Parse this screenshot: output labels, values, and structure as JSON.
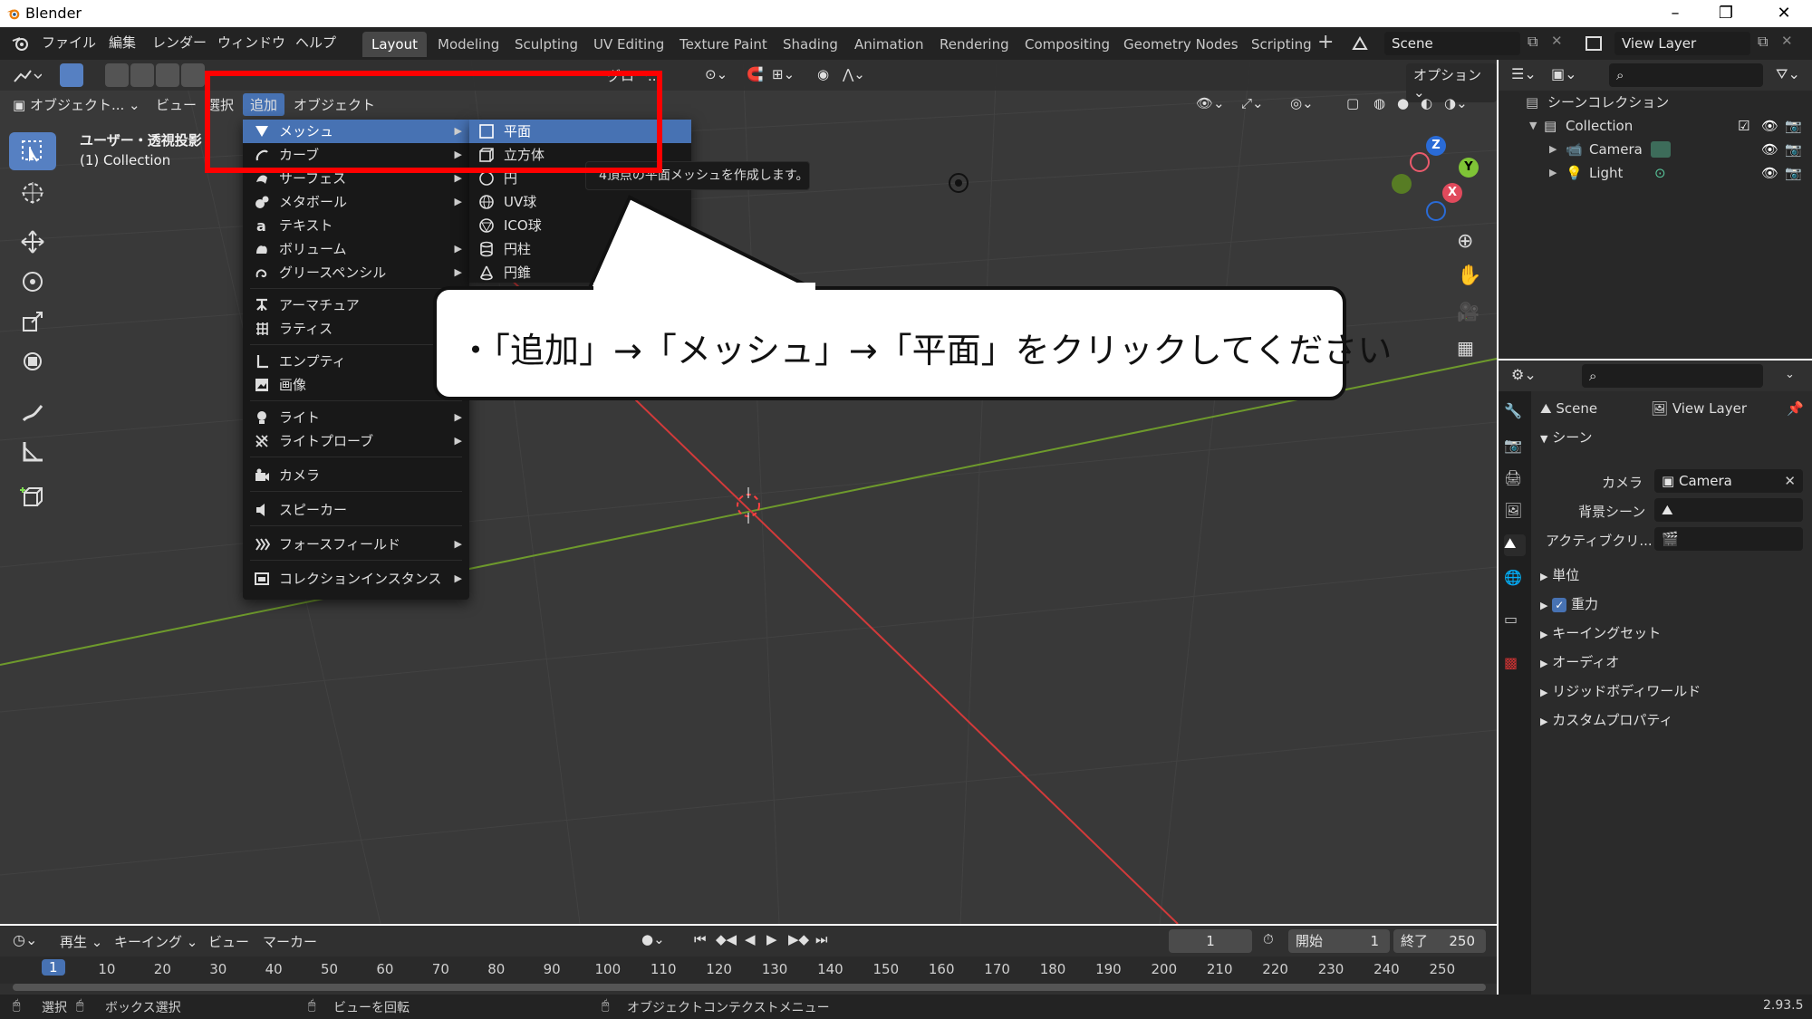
{
  "window": {
    "title": "Blender"
  },
  "menubar": {
    "items": [
      "ファイル",
      "編集",
      "レンダー",
      "ウィンドウ",
      "ヘルプ"
    ]
  },
  "workspaces": {
    "tabs": [
      "Layout",
      "Modeling",
      "Sculpting",
      "UV Editing",
      "Texture Paint",
      "Shading",
      "Animation",
      "Rendering",
      "Compositing",
      "Geometry Nodes",
      "Scripting"
    ],
    "active": "Layout"
  },
  "scene": {
    "name": "Scene",
    "view_layer": "View Layer"
  },
  "viewport": {
    "mode": "オブジェクト...",
    "header_menus": [
      "ビュー",
      "選択",
      "追加",
      "オブジェクト"
    ],
    "options_label": "オプション",
    "transform_label": "グロー...",
    "view_name": "ユーザー・透視投影",
    "collection_info": "(1) Collection"
  },
  "add_menu": {
    "items": [
      {
        "label": "メッシュ",
        "icon": "mesh-icon",
        "submenu": true
      },
      {
        "label": "カーブ",
        "icon": "curve-icon",
        "submenu": true
      },
      {
        "label": "サーフェス",
        "icon": "surface-icon",
        "submenu": true
      },
      {
        "label": "メタボール",
        "icon": "metaball-icon",
        "submenu": true
      },
      {
        "label": "テキスト",
        "icon": "text-icon",
        "submenu": false
      },
      {
        "label": "ボリューム",
        "icon": "volume-icon",
        "submenu": true
      },
      {
        "label": "グリースペンシル",
        "icon": "grease-pencil-icon",
        "submenu": true
      },
      {
        "label": "アーマチュア",
        "icon": "armature-icon",
        "submenu": false
      },
      {
        "label": "ラティス",
        "icon": "lattice-icon",
        "submenu": false
      },
      {
        "label": "エンプティ",
        "icon": "empty-icon",
        "submenu": true
      },
      {
        "label": "画像",
        "icon": "image-icon",
        "submenu": true
      },
      {
        "label": "ライト",
        "icon": "light-icon",
        "submenu": true
      },
      {
        "label": "ライトプローブ",
        "icon": "light-probe-icon",
        "submenu": true
      },
      {
        "label": "カメラ",
        "icon": "camera-icon",
        "submenu": false
      },
      {
        "label": "スピーカー",
        "icon": "speaker-icon",
        "submenu": false
      },
      {
        "label": "フォースフィールド",
        "icon": "force-field-icon",
        "submenu": true
      },
      {
        "label": "コレクションインスタンス",
        "icon": "collection-instance-icon",
        "submenu": true
      }
    ]
  },
  "mesh_menu": {
    "items": [
      "平面",
      "立方体",
      "円",
      "UV球",
      "ICO球",
      "円柱",
      "円錐"
    ]
  },
  "tooltip": "4頂点の平面メッシュを作成します。",
  "callout": "・「追加」→「メッシュ」→「平面」をクリックしてください",
  "outliner": {
    "root": "シーンコレクション",
    "collection": "Collection",
    "objects": [
      "Camera",
      "Light"
    ]
  },
  "properties": {
    "breadcrumb_scene": "Scene",
    "breadcrumb_layer": "View Layer",
    "section": "シーン",
    "camera_label": "カメラ",
    "camera_value": "Camera",
    "bg_scene_label": "背景シーン",
    "active_clip_label": "アクティブクリ...",
    "panels": [
      "単位",
      "重力",
      "キーイングセット",
      "オーディオ",
      "リジッドボディワールド",
      "カスタムプロパティ"
    ]
  },
  "timeline": {
    "menus": [
      "再生",
      "キーイング",
      "ビュー",
      "マーカー"
    ],
    "current_frame": "1",
    "start_label": "開始",
    "start_value": "1",
    "end_label": "終了",
    "end_value": "250",
    "ticks": [
      "1",
      "10",
      "20",
      "30",
      "40",
      "50",
      "60",
      "70",
      "80",
      "90",
      "100",
      "110",
      "120",
      "130",
      "140",
      "150",
      "160",
      "170",
      "180",
      "190",
      "200",
      "210",
      "220",
      "230",
      "240",
      "250"
    ]
  },
  "statusbar": {
    "select": "選択",
    "box_select": "ボックス選択",
    "rotate_view": "ビューを回転",
    "context_menu": "オブジェクトコンテクストメニュー",
    "version": "2.93.5"
  },
  "colors": {
    "accent": "#4772b3",
    "highlight_box": "#ff0000",
    "x_axis": "#d23a3a",
    "y_axis": "#6e9a2c"
  }
}
